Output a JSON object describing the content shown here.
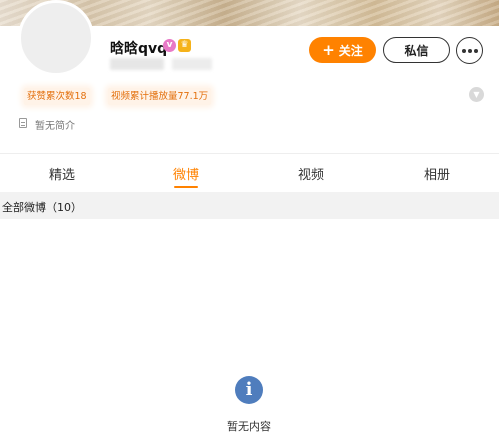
{
  "profile": {
    "username": "晗晗qvq",
    "badges": {
      "vip_icon": "vip-icon",
      "crown_icon": "crown-icon"
    },
    "bio": "暂无简介"
  },
  "actions": {
    "follow_label": "关注",
    "message_label": "私信"
  },
  "stats": {
    "likes": "获赞累次数18",
    "views": "视频累计播放量77.1万"
  },
  "tabs": [
    {
      "label": "精选",
      "active": false
    },
    {
      "label": "微博",
      "active": true
    },
    {
      "label": "视频",
      "active": false
    },
    {
      "label": "相册",
      "active": false
    }
  ],
  "feed": {
    "section_title": "全部微博（10）",
    "empty_message": "暂无内容"
  },
  "colors": {
    "accent": "#ff8200",
    "stat_bg": "#fff3e8",
    "info_icon": "#4f7dbd"
  }
}
